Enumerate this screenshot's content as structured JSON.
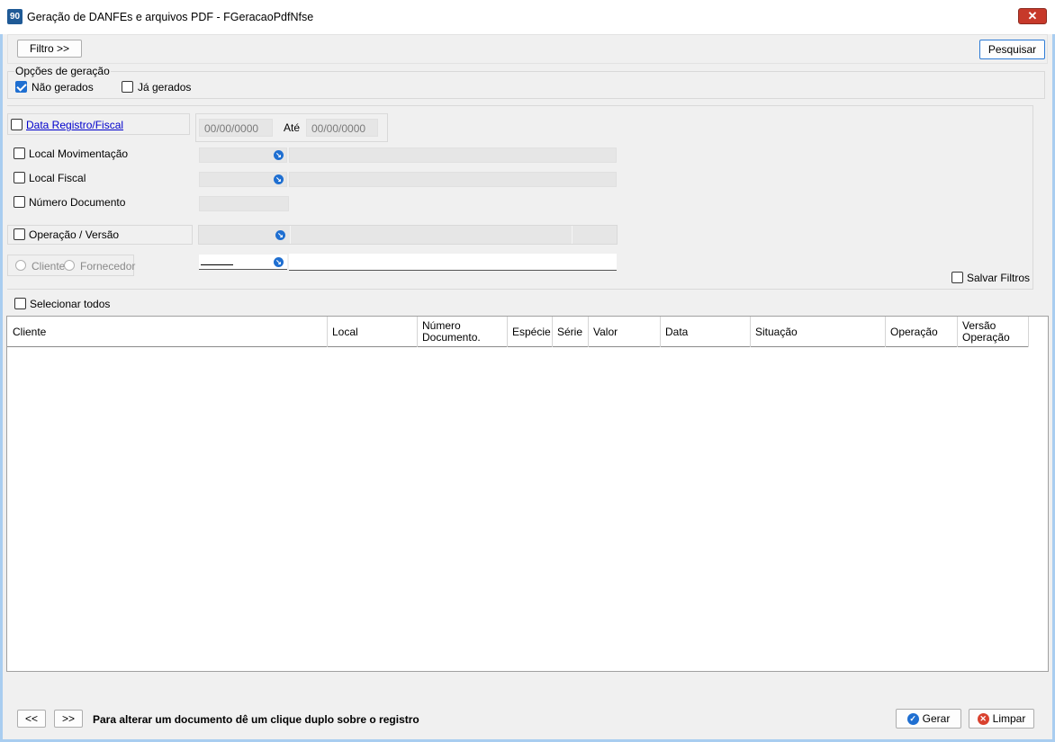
{
  "window": {
    "title": "Geração de DANFEs e arquivos PDF - FGeracaoPdfNfse",
    "app_icon_text": "90",
    "close_symbol": "✕"
  },
  "toolbar": {
    "filter_button": "Filtro >>",
    "search_button": "Pesquisar"
  },
  "generation_options": {
    "title": "Opções de geração",
    "not_generated": {
      "label": "Não gerados",
      "checked": true
    },
    "already_generated": {
      "label": "Já gerados",
      "checked": false
    }
  },
  "filters": {
    "date_registry": {
      "label": "Data Registro/Fiscal",
      "from": "00/00/0000",
      "to_label": "Até",
      "to": "00/00/0000"
    },
    "local_movement": {
      "label": "Local Movimentação"
    },
    "local_fiscal": {
      "label": "Local Fiscal"
    },
    "document_number": {
      "label": "Número Documento"
    },
    "operation_version": {
      "label": "Operação / Versão"
    },
    "party": {
      "client_label": "Cliente",
      "supplier_label": "Fornecedor"
    },
    "save_filters": {
      "label": "Salvar Filtros"
    }
  },
  "select_all": {
    "label": "Selecionar todos"
  },
  "table": {
    "columns": [
      "Cliente",
      "Local",
      "Número Documento.",
      "Espécie",
      "Série",
      "Valor",
      "Data",
      "Situação",
      "Operação",
      "Versão Operação"
    ],
    "rows": []
  },
  "footer": {
    "prev_button": "<<",
    "next_button": ">>",
    "hint": "Para alterar um documento dê um clique duplo sobre o registro",
    "generate_button": "Gerar",
    "clear_button": "Limpar"
  },
  "colors": {
    "accent": "#1f6fd1",
    "close": "#c7392a",
    "clear_icon": "#d9412e",
    "link": "#0000cc"
  },
  "icons": {
    "check": "check-icon",
    "lookup": "lookup-arrow-icon",
    "generate": "check-circle-icon",
    "clear": "x-circle-icon"
  }
}
